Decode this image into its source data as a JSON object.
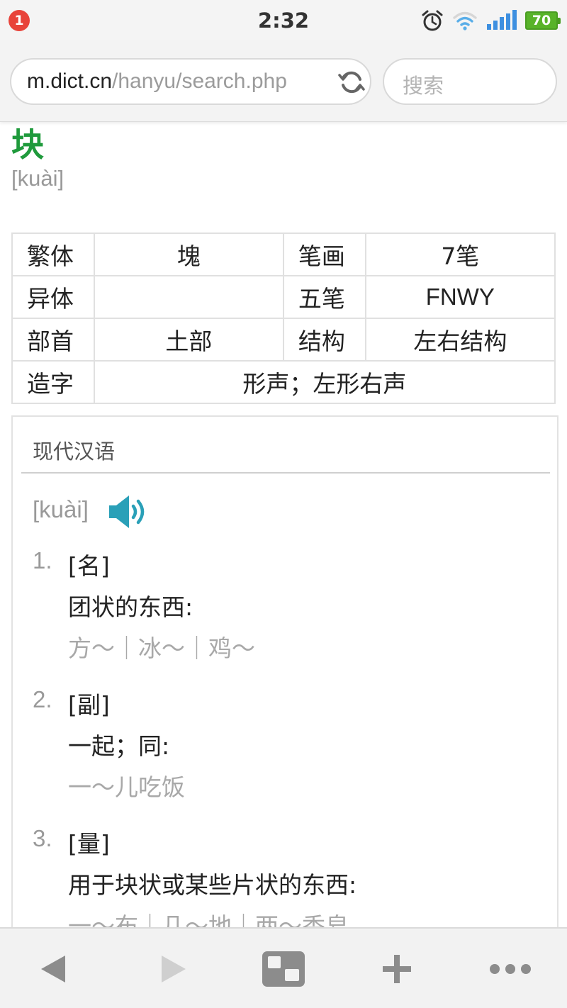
{
  "status_bar": {
    "notification_count": "1",
    "time": "2:32",
    "battery": "70",
    "icons": [
      "alarm-icon",
      "wifi-icon",
      "signal-icon",
      "battery-icon"
    ]
  },
  "address_bar": {
    "url_domain": "m.dict.cn",
    "url_path": "/hanyu/search.php",
    "search_placeholder": "搜索"
  },
  "entry": {
    "character": "块",
    "pinyin": "[kuài]",
    "info_table": {
      "traditional_label": "繁体",
      "traditional_value": "塊",
      "strokes_label": "笔画",
      "strokes_value": "7笔",
      "variant_label": "异体",
      "variant_value": "",
      "wubi_label": "五笔",
      "wubi_value": "FNWY",
      "radical_label": "部首",
      "radical_value": "土部",
      "structure_label": "结构",
      "structure_value": "左右结构",
      "formation_label": "造字",
      "formation_value": "形声；左形右声"
    }
  },
  "modern_chinese": {
    "title": "现代汉语",
    "pinyin": "[kuài]",
    "senses": [
      {
        "num": "1.",
        "pos": "[名]",
        "definition": "团状的东西:",
        "examples": "方～｜冰～｜鸡～"
      },
      {
        "num": "2.",
        "pos": "[副]",
        "definition": "一起；同:",
        "examples": "一～儿吃饭"
      },
      {
        "num": "3.",
        "pos": "[量]",
        "definition": "用于块状或某些片状的东西:",
        "examples": "一～布｜几～地｜两～香皂"
      }
    ]
  },
  "colors": {
    "headword_green": "#1f9a3c",
    "speaker_teal": "#2aa0b8",
    "badge_red": "#e8433a",
    "battery_green": "#58b329",
    "signal_blue": "#3d8fe0"
  }
}
